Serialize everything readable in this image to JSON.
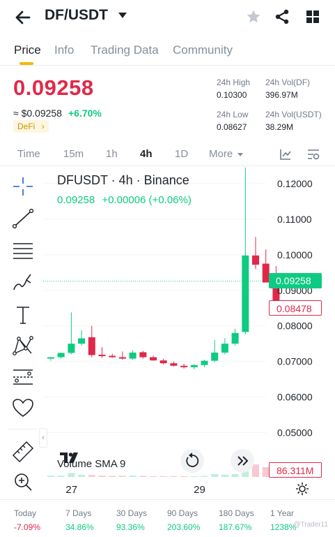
{
  "header": {
    "pair": "DF/USDT"
  },
  "tabs": [
    "Price",
    "Info",
    "Trading Data",
    "Community"
  ],
  "price": {
    "last": "0.09258",
    "fiat": "≈ $0.09258",
    "change": "+6.70%",
    "tag": "DeFi",
    "high_label": "24h High",
    "high": "0.10300",
    "low_label": "24h Low",
    "low": "0.08627",
    "vol_base_label": "24h Vol(DF)",
    "vol_base": "396.97M",
    "vol_quote_label": "24h Vol(USDT)",
    "vol_quote": "38.29M"
  },
  "timeframes": [
    "Time",
    "15m",
    "1h",
    "4h",
    "1D",
    "More"
  ],
  "chart": {
    "title": "DFUSDT · 4h · Binance",
    "last": "0.09258",
    "change": "+0.00006 (+0.06%)",
    "price_tag": "0.09258",
    "low_tag": "0.08478",
    "volume_label": "Volume  SMA 9",
    "volume_tag": "86.311M",
    "x_labels": [
      "27",
      "29"
    ],
    "y_ticks": [
      "0.12000",
      "0.11000",
      "0.10000",
      "0.09000",
      "0.08000",
      "0.07000",
      "0.06000",
      "0.05000"
    ],
    "colors": {
      "up": "#0ecb81",
      "down": "#e0294a"
    }
  },
  "chart_data": {
    "type": "candlestick",
    "ylim": [
      0.045,
      0.1245
    ],
    "y_ticks": [
      0.12,
      0.11,
      0.1,
      0.09,
      0.08,
      0.07,
      0.06,
      0.05
    ],
    "candles": [
      {
        "o": 0.0708,
        "h": 0.0712,
        "l": 0.0702,
        "c": 0.0712
      },
      {
        "o": 0.0712,
        "h": 0.0725,
        "l": 0.0708,
        "c": 0.0724
      },
      {
        "o": 0.0724,
        "h": 0.0838,
        "l": 0.072,
        "c": 0.075
      },
      {
        "o": 0.075,
        "h": 0.0788,
        "l": 0.0745,
        "c": 0.0765
      },
      {
        "o": 0.0768,
        "h": 0.08,
        "l": 0.0712,
        "c": 0.0718
      },
      {
        "o": 0.0719,
        "h": 0.074,
        "l": 0.071,
        "c": 0.0715
      },
      {
        "o": 0.0716,
        "h": 0.0722,
        "l": 0.071,
        "c": 0.0712
      },
      {
        "o": 0.0712,
        "h": 0.0728,
        "l": 0.0705,
        "c": 0.0708
      },
      {
        "o": 0.0708,
        "h": 0.0732,
        "l": 0.0704,
        "c": 0.0725
      },
      {
        "o": 0.0726,
        "h": 0.073,
        "l": 0.0708,
        "c": 0.0712
      },
      {
        "o": 0.0712,
        "h": 0.0716,
        "l": 0.0702,
        "c": 0.0703
      },
      {
        "o": 0.0703,
        "h": 0.0708,
        "l": 0.0692,
        "c": 0.0695
      },
      {
        "o": 0.0695,
        "h": 0.07,
        "l": 0.0686,
        "c": 0.0688
      },
      {
        "o": 0.0688,
        "h": 0.0694,
        "l": 0.068,
        "c": 0.0684
      },
      {
        "o": 0.0684,
        "h": 0.0692,
        "l": 0.0678,
        "c": 0.069
      },
      {
        "o": 0.069,
        "h": 0.0705,
        "l": 0.0684,
        "c": 0.0702
      },
      {
        "o": 0.0702,
        "h": 0.076,
        "l": 0.0698,
        "c": 0.0725
      },
      {
        "o": 0.0725,
        "h": 0.0765,
        "l": 0.072,
        "c": 0.075
      },
      {
        "o": 0.075,
        "h": 0.0792,
        "l": 0.0745,
        "c": 0.078
      },
      {
        "o": 0.0783,
        "h": 0.1245,
        "l": 0.0776,
        "c": 0.0998
      },
      {
        "o": 0.0998,
        "h": 0.105,
        "l": 0.096,
        "c": 0.0972
      },
      {
        "o": 0.0975,
        "h": 0.1015,
        "l": 0.093,
        "c": 0.0922
      },
      {
        "o": 0.094,
        "h": 0.0968,
        "l": 0.0848,
        "c": 0.0852
      }
    ],
    "volume": [
      0.05,
      0.05,
      0.14,
      0.08,
      0.07,
      0.05,
      0.04,
      0.04,
      0.05,
      0.04,
      0.03,
      0.03,
      0.03,
      0.03,
      0.03,
      0.04,
      0.1,
      0.08,
      0.1,
      0.7,
      0.45,
      0.35,
      0.25
    ],
    "x_labels": [
      "27",
      "29"
    ]
  },
  "performance": [
    {
      "label": "Today",
      "value": "-7.09%"
    },
    {
      "label": "7 Days",
      "value": "34.86%"
    },
    {
      "label": "30 Days",
      "value": "93.36%"
    },
    {
      "label": "90 Days",
      "value": "203.60%"
    },
    {
      "label": "180 Days",
      "value": "187.67%"
    },
    {
      "label": "1 Year",
      "value": "1238%"
    }
  ],
  "watermark": "@Trader11"
}
